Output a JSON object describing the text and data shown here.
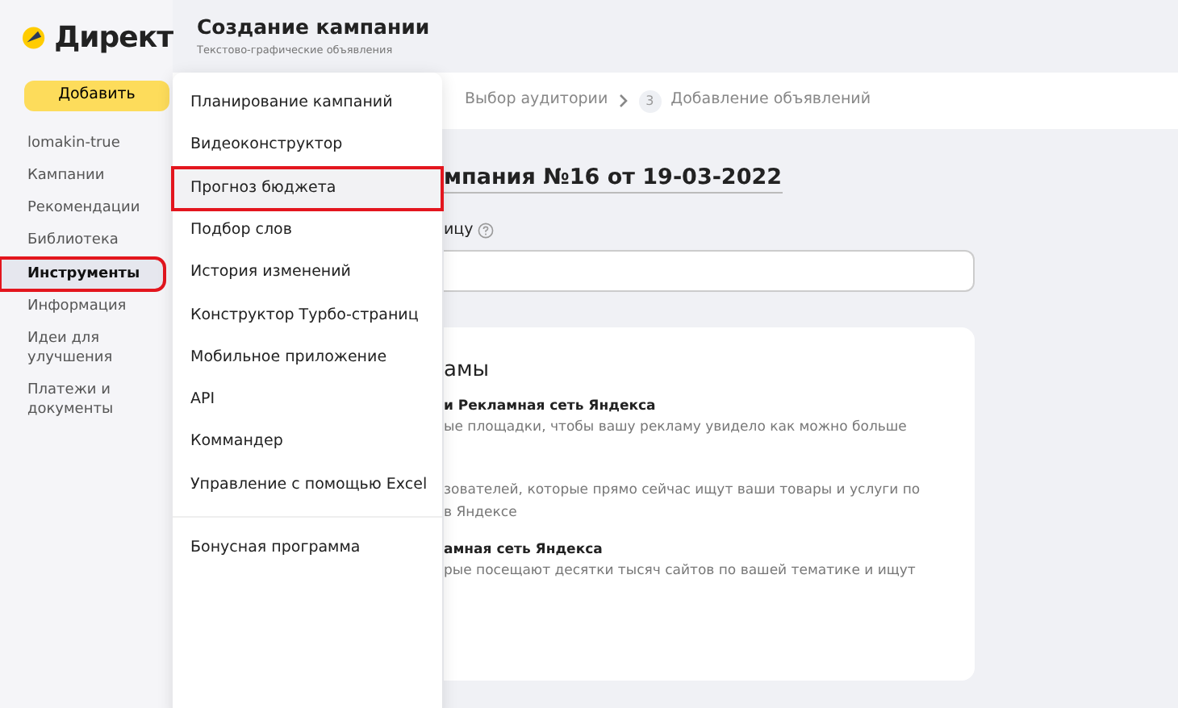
{
  "logo": {
    "text": "Директ"
  },
  "header": {
    "title": "Создание кампании",
    "subtitle": "Текстово-графические объявления"
  },
  "sidebar": {
    "add_button": "Добавить",
    "items": [
      {
        "label": "lomakin-true",
        "selected": false,
        "highlighted": false
      },
      {
        "label": "Кампании",
        "selected": false,
        "highlighted": false
      },
      {
        "label": "Рекомендации",
        "selected": false,
        "highlighted": false
      },
      {
        "label": "Библиотека",
        "selected": false,
        "highlighted": false
      },
      {
        "label": "Инструменты",
        "selected": true,
        "highlighted": true
      },
      {
        "label": "Информация",
        "selected": false,
        "highlighted": false
      },
      {
        "label": "Идеи для улучшения",
        "selected": false,
        "highlighted": false
      },
      {
        "label": "Платежи и документы",
        "selected": false,
        "highlighted": false
      }
    ]
  },
  "dropdown": {
    "groups": [
      [
        {
          "label": "Планирование кампаний",
          "selected": false,
          "highlighted": false
        },
        {
          "label": "Видеоконструктор",
          "selected": false,
          "highlighted": false
        },
        {
          "label": "Прогноз бюджета",
          "selected": true,
          "highlighted": true
        },
        {
          "label": "Подбор слов",
          "selected": false,
          "highlighted": false
        },
        {
          "label": "История изменений",
          "selected": false,
          "highlighted": false
        },
        {
          "label": "Конструктор Турбо-страниц",
          "selected": false,
          "highlighted": false
        },
        {
          "label": "Мобильное приложение",
          "selected": false,
          "highlighted": false
        },
        {
          "label": "API",
          "selected": false,
          "highlighted": false
        },
        {
          "label": "Коммандер",
          "selected": false,
          "highlighted": false
        },
        {
          "label": "Управление с помощью Excel",
          "selected": false,
          "highlighted": false
        }
      ],
      [
        {
          "label": "Бонусная программа",
          "selected": false,
          "highlighted": false
        }
      ]
    ]
  },
  "steps": [
    {
      "label": "Выбор аудитории"
    },
    {
      "number": "3",
      "label": "Добавление объявлений"
    }
  ],
  "campaign_name": "мпания №16 от 19-03-2022",
  "field_label": "ицу",
  "card": {
    "title": "амы",
    "options": [
      {
        "title": "и Рекламная сеть Яндекса",
        "description": [
          "ые площадки, чтобы вашу рекламу увидело как можно больше"
        ]
      },
      {
        "description": [
          "зователей, которые прямо сейчас ищут ваши товары и услуги по",
          "в Яндексе"
        ]
      },
      {
        "title": "амная сеть Яндекса",
        "description": [
          "рые посещают десятки тысяч сайтов по вашей тематике и ищут"
        ]
      }
    ]
  }
}
